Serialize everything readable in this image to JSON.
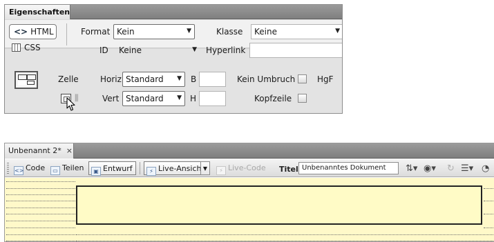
{
  "properties_panel": {
    "tab_label": "Eigenschaften",
    "html_button": "HTML",
    "css_button": "CSS",
    "format": {
      "label": "Format",
      "value": "Kein"
    },
    "class": {
      "label": "Klasse",
      "value": "Keine"
    },
    "id": {
      "label": "ID",
      "value": "Keine"
    },
    "hyperlink": {
      "label": "Hyperlink",
      "value": ""
    },
    "cell_label": "Zelle",
    "horiz": {
      "label": "Horiz",
      "value": "Standard"
    },
    "vert": {
      "label": "Vert",
      "value": "Standard"
    },
    "width": {
      "label": "B",
      "value": ""
    },
    "height": {
      "label": "H",
      "value": ""
    },
    "no_wrap": {
      "label": "Kein Umbruch",
      "checked": false
    },
    "header": {
      "label": "Kopfzeile",
      "checked": false
    },
    "bg_label": "HgF"
  },
  "document": {
    "tab_label": "Unbenannt 2*",
    "tab_close": "×",
    "toolbar": {
      "code": "Code",
      "split": "Teilen",
      "design": "Entwurf",
      "live_view": "Live-Ansicht",
      "live_code": "Live-Code",
      "title_label": "Titel:",
      "title_value": "Unbenanntes Dokument"
    }
  },
  "icons": {
    "html": "code-brackets-icon",
    "css": "css-panel-icon",
    "cell_layout": "table-cell-icon",
    "merge_cells": "merge-cells-icon",
    "split_cell": "split-cell-icon",
    "mouse_cursor": "cursor-arrow-icon"
  }
}
